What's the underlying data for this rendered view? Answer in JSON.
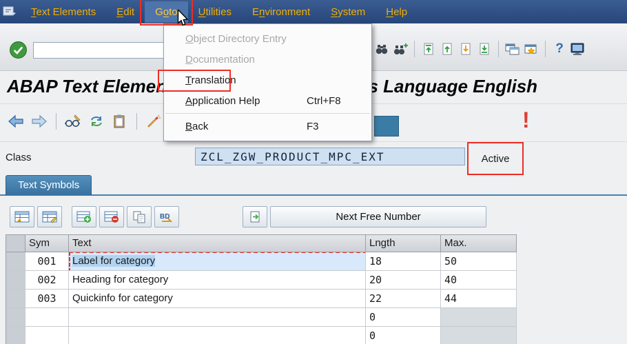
{
  "menu_bar": {
    "items": [
      {
        "label": "Text Elements",
        "underline": 0
      },
      {
        "label": "Edit",
        "underline": 0
      },
      {
        "label": "Goto",
        "underline": 1
      },
      {
        "label": "Utilities",
        "underline": 0
      },
      {
        "label": "Environment",
        "underline": 1
      },
      {
        "label": "System",
        "underline": 0
      },
      {
        "label": "Help",
        "underline": 0
      }
    ]
  },
  "goto_menu": {
    "items": [
      {
        "label": "Object Directory Entry",
        "shortcut": "",
        "underline": 0,
        "disabled": true
      },
      {
        "label": "Documentation",
        "shortcut": "",
        "underline": 0,
        "disabled": true
      },
      {
        "label": "Translation",
        "shortcut": "",
        "underline": 0,
        "disabled": false
      },
      {
        "label": "Application Help",
        "shortcut": "Ctrl+F8",
        "underline": 0,
        "disabled": false
      },
      {
        "label": "Back",
        "shortcut": "F3",
        "underline": 0,
        "disabled": false
      }
    ]
  },
  "toolbar": {
    "command_value": ""
  },
  "title": "ABAP Text Elements: Display Text Symbols Language English",
  "status_mark": "!",
  "class_section": {
    "label": "Class",
    "value": "ZCL_ZGW_PRODUCT_MPC_EXT",
    "status": "Active"
  },
  "tabs": [
    {
      "label": "Text Symbols"
    }
  ],
  "table_toolbar": {
    "next_free_number": "Next Free Number"
  },
  "table": {
    "columns": [
      "",
      "Sym",
      "Text",
      "Lngth",
      "Max."
    ],
    "rows": [
      {
        "sym": "001",
        "text": "Label for category",
        "lngth": "18",
        "max": "50",
        "selected": true
      },
      {
        "sym": "002",
        "text": "Heading for category",
        "lngth": "20",
        "max": "40",
        "selected": false
      },
      {
        "sym": "003",
        "text": "Quickinfo for category",
        "lngth": "22",
        "max": "44",
        "selected": false
      },
      {
        "sym": "",
        "text": "",
        "lngth": "0",
        "max": "",
        "selected": false
      },
      {
        "sym": "",
        "text": "",
        "lngth": "0",
        "max": "",
        "selected": false
      }
    ]
  },
  "colors": {
    "annotation_red": "#ee2d24",
    "menu_text": "#f2ae00",
    "tab_blue": "#4a82ad"
  }
}
